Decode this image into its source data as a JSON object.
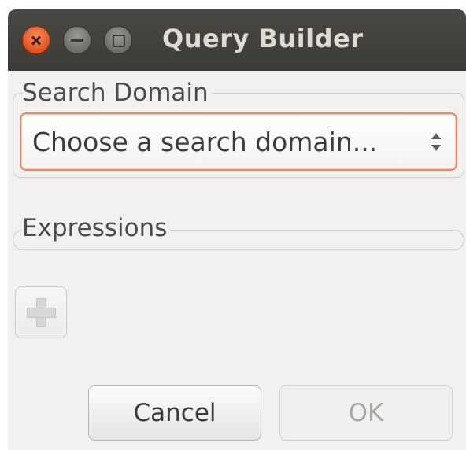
{
  "window": {
    "title": "Query Builder",
    "controls": [
      "close",
      "minimize",
      "maximize"
    ]
  },
  "search_domain": {
    "label": "Search Domain",
    "combo_value": "Choose a search domain..."
  },
  "expressions": {
    "label": "Expressions",
    "add_icon": "plus-icon"
  },
  "buttons": {
    "cancel_label": "Cancel",
    "ok_label": "OK"
  },
  "colors": {
    "titlebar": "#3c3b37",
    "close_button": "#e2531e",
    "focus_border": "#e58a6a",
    "background": "#f2f1f0"
  }
}
